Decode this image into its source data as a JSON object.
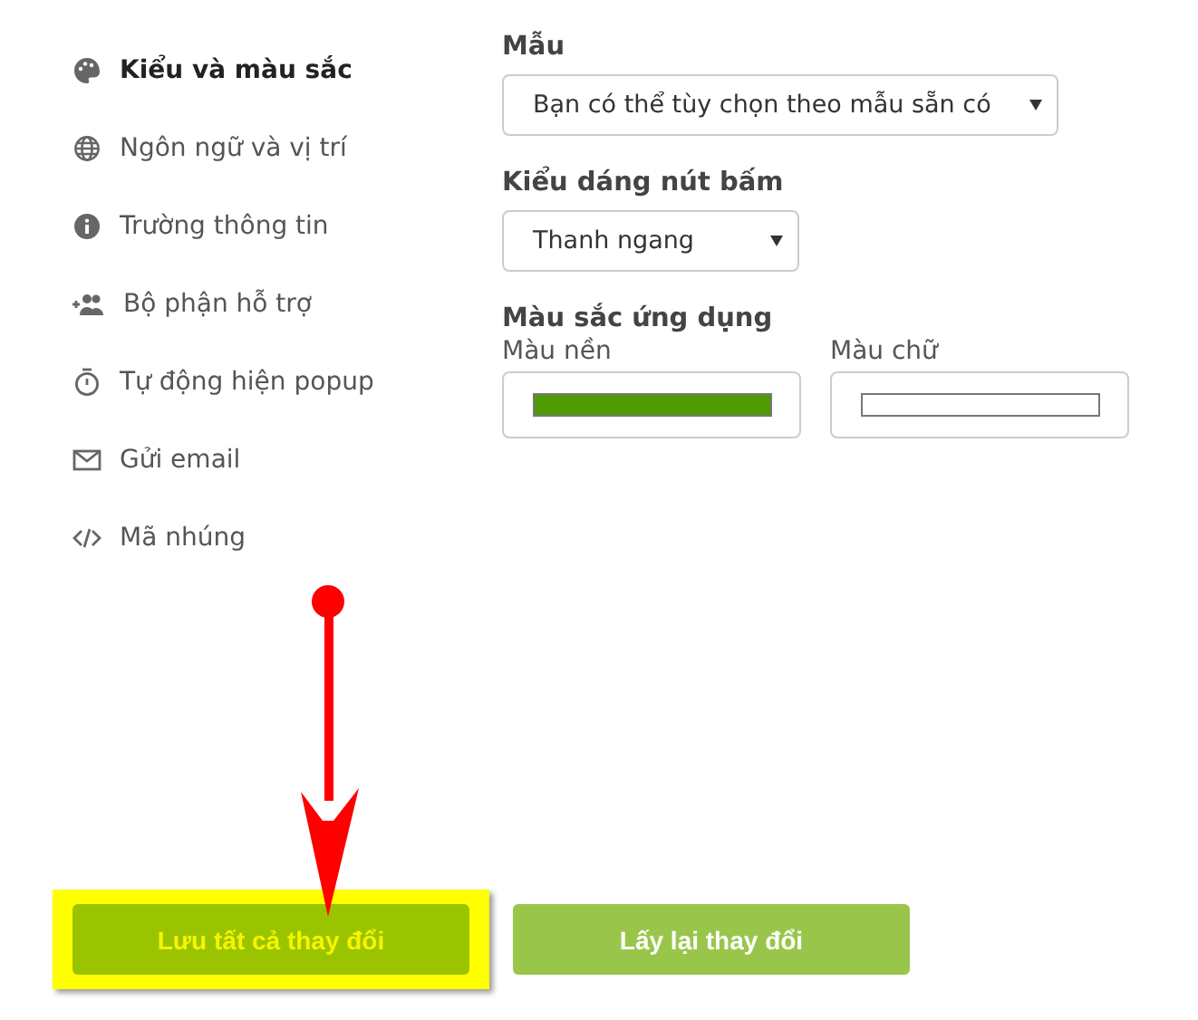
{
  "sidebar": {
    "items": [
      {
        "label": "Kiểu và màu sắc",
        "selected": true
      },
      {
        "label": "Ngôn ngữ và vị trí",
        "selected": false
      },
      {
        "label": "Trường thông tin",
        "selected": false
      },
      {
        "label": "Bộ phận hỗ trợ",
        "selected": false
      },
      {
        "label": "Tự động hiện popup",
        "selected": false
      },
      {
        "label": "Gửi email",
        "selected": false
      },
      {
        "label": "Mã nhúng",
        "selected": false
      }
    ]
  },
  "template": {
    "label": "Mẫu",
    "value": "Bạn có thể tùy chọn theo mẫu sẵn có"
  },
  "button_style": {
    "label": "Kiểu dáng nút bấm",
    "value": "Thanh ngang"
  },
  "app_colors": {
    "label": "Màu sắc ứng dụng",
    "fields": [
      {
        "label": "Màu nền",
        "color": "#4e9a00"
      },
      {
        "label": "Màu chữ",
        "color": "#ffffff"
      }
    ]
  },
  "buttons": [
    {
      "label": "Lưu tất cả thay đổi",
      "highlighted": true
    },
    {
      "label": "Lấy lại thay đổi",
      "highlighted": false
    }
  ]
}
